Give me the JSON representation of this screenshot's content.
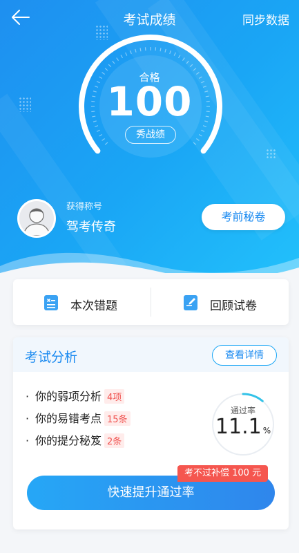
{
  "header": {
    "title": "考试成绩",
    "sync_label": "同步数据"
  },
  "score": {
    "status": "合格",
    "value": "100",
    "show_label": "秀战绩",
    "gauge_fraction": 1.0
  },
  "profile": {
    "caption": "获得称号",
    "title": "驾考传奇",
    "secret_button": "考前秘卷"
  },
  "actions": [
    {
      "label": "本次错题",
      "icon": "wrong-questions-icon"
    },
    {
      "label": "回顾试卷",
      "icon": "review-paper-icon"
    }
  ],
  "analysis": {
    "title": "考试分析",
    "detail_button": "查看详情",
    "items": [
      {
        "label": "你的弱项分析",
        "tag": "4项"
      },
      {
        "label": "你的易错考点",
        "tag": "15条"
      },
      {
        "label": "你的提分秘笈",
        "tag": "2条"
      }
    ],
    "pass_rate": {
      "label": "通过率",
      "value": "11.1",
      "unit": "%",
      "fraction": 0.111
    },
    "cta_label": "快速提升通过率",
    "promo_label": "考不过补偿 100 元"
  },
  "colors": {
    "primary": "#1a8af0",
    "accent_red": "#f0524f",
    "background": "#f4f6f9"
  }
}
